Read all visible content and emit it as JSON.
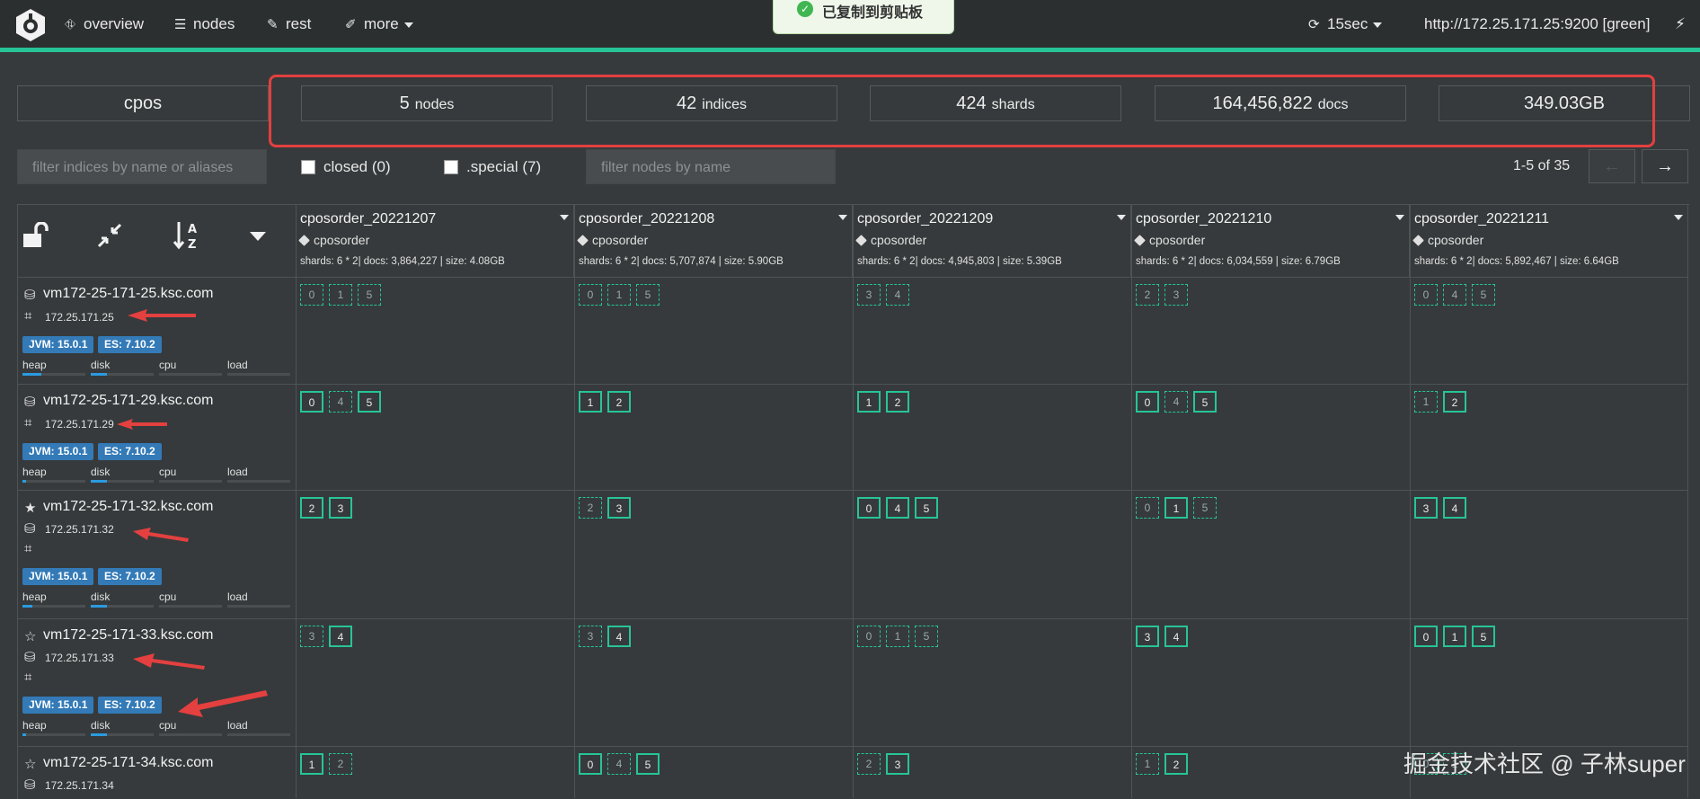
{
  "nav": {
    "overview": "overview",
    "nodes": "nodes",
    "rest": "rest",
    "more": "more",
    "refresh": "15sec",
    "cluster_url": "http://172.25.171.25:9200 [green]"
  },
  "toast": {
    "text": "已复制到剪贴板"
  },
  "stats": {
    "cluster": "cpos",
    "nodes_num": "5",
    "nodes_unit": "nodes",
    "indices_num": "42",
    "indices_unit": "indices",
    "shards_num": "424",
    "shards_unit": "shards",
    "docs_num": "164,456,822",
    "docs_unit": "docs",
    "size": "349.03GB"
  },
  "filters": {
    "indices_placeholder": "filter indices by name or aliases",
    "closed": "closed (0)",
    "special": ".special (7)",
    "nodes_placeholder": "filter nodes by name",
    "pager": "1-5 of 35",
    "prev": "←",
    "next": "→"
  },
  "indices": [
    {
      "name": "cposorder_20221207",
      "alias": "cposorder",
      "stats": "shards: 6 * 2| docs: 3,864,227 | size: 4.08GB"
    },
    {
      "name": "cposorder_20221208",
      "alias": "cposorder",
      "stats": "shards: 6 * 2| docs: 5,707,874 | size: 5.90GB"
    },
    {
      "name": "cposorder_20221209",
      "alias": "cposorder",
      "stats": "shards: 6 * 2| docs: 4,945,803 | size: 5.39GB"
    },
    {
      "name": "cposorder_20221210",
      "alias": "cposorder",
      "stats": "shards: 6 * 2| docs: 6,034,559 | size: 6.79GB"
    },
    {
      "name": "cposorder_20221211",
      "alias": "cposorder",
      "stats": "shards: 6 * 2| docs: 5,892,467 | size: 6.64GB"
    }
  ],
  "metric_labels": {
    "heap": "heap",
    "disk": "disk",
    "cpu": "cpu",
    "load": "load"
  },
  "nodes": [
    {
      "name": "vm172-25-171-25.ksc.com",
      "ip": "172.25.171.25",
      "jvm": "JVM: 15.0.1",
      "es": "ES: 7.10.2",
      "heap": 0.3,
      "disk": 0.25
    },
    {
      "name": "vm172-25-171-29.ksc.com",
      "ip": "172.25.171.29",
      "jvm": "JVM: 15.0.1",
      "es": "ES: 7.10.2",
      "heap": 0.05,
      "disk": 0.25
    },
    {
      "name": "vm172-25-171-32.ksc.com",
      "ip": "172.25.171.32",
      "jvm": "JVM: 15.0.1",
      "es": "ES: 7.10.2",
      "heap": 0.15,
      "disk": 0.25
    },
    {
      "name": "vm172-25-171-33.ksc.com",
      "ip": "172.25.171.33",
      "jvm": "JVM: 15.0.1",
      "es": "ES: 7.10.2",
      "heap": 0.05,
      "disk": 0.25
    },
    {
      "name": "vm172-25-171-34.ksc.com",
      "ip": "172.25.171.34"
    }
  ],
  "shards": [
    [
      [
        [
          "0",
          "r"
        ],
        [
          "1",
          "r"
        ],
        [
          "5",
          "r"
        ]
      ],
      [
        [
          "0",
          "r"
        ],
        [
          "1",
          "r"
        ],
        [
          "5",
          "r"
        ]
      ],
      [
        [
          "3",
          "r"
        ],
        [
          "4",
          "r"
        ]
      ],
      [
        [
          "2",
          "r"
        ],
        [
          "3",
          "r"
        ]
      ],
      [
        [
          "0",
          "r"
        ],
        [
          "4",
          "r"
        ],
        [
          "5",
          "r"
        ]
      ]
    ],
    [
      [
        [
          "0",
          "p"
        ],
        [
          "4",
          "r"
        ],
        [
          "5",
          "p"
        ]
      ],
      [
        [
          "1",
          "p"
        ],
        [
          "2",
          "p"
        ]
      ],
      [
        [
          "1",
          "p"
        ],
        [
          "2",
          "p"
        ]
      ],
      [
        [
          "0",
          "p"
        ],
        [
          "4",
          "r"
        ],
        [
          "5",
          "p"
        ]
      ],
      [
        [
          "1",
          "r"
        ],
        [
          "2",
          "p"
        ]
      ]
    ],
    [
      [
        [
          "2",
          "p"
        ],
        [
          "3",
          "p"
        ]
      ],
      [
        [
          "2",
          "r"
        ],
        [
          "3",
          "p"
        ]
      ],
      [
        [
          "0",
          "p"
        ],
        [
          "4",
          "p"
        ],
        [
          "5",
          "p"
        ]
      ],
      [
        [
          "0",
          "r"
        ],
        [
          "1",
          "p"
        ],
        [
          "5",
          "r"
        ]
      ],
      [
        [
          "3",
          "p"
        ],
        [
          "4",
          "p"
        ]
      ]
    ],
    [
      [
        [
          "3",
          "r"
        ],
        [
          "4",
          "p"
        ]
      ],
      [
        [
          "3",
          "r"
        ],
        [
          "4",
          "p"
        ]
      ],
      [
        [
          "0",
          "r"
        ],
        [
          "1",
          "r"
        ],
        [
          "5",
          "r"
        ]
      ],
      [
        [
          "3",
          "p"
        ],
        [
          "4",
          "p"
        ]
      ],
      [
        [
          "0",
          "p"
        ],
        [
          "1",
          "p"
        ],
        [
          "5",
          "p"
        ]
      ]
    ],
    [
      [
        [
          "1",
          "p"
        ],
        [
          "2",
          "r"
        ]
      ],
      [
        [
          "0",
          "p"
        ],
        [
          "4",
          "r"
        ],
        [
          "5",
          "p"
        ]
      ],
      [
        [
          "2",
          "r"
        ],
        [
          "3",
          "p"
        ]
      ],
      [
        [
          "1",
          "r"
        ],
        [
          "2",
          "p"
        ]
      ],
      [
        [
          "0",
          "r"
        ],
        [
          "1",
          "r"
        ]
      ]
    ]
  ],
  "watermark": "掘金技术社区 @ 子林super"
}
